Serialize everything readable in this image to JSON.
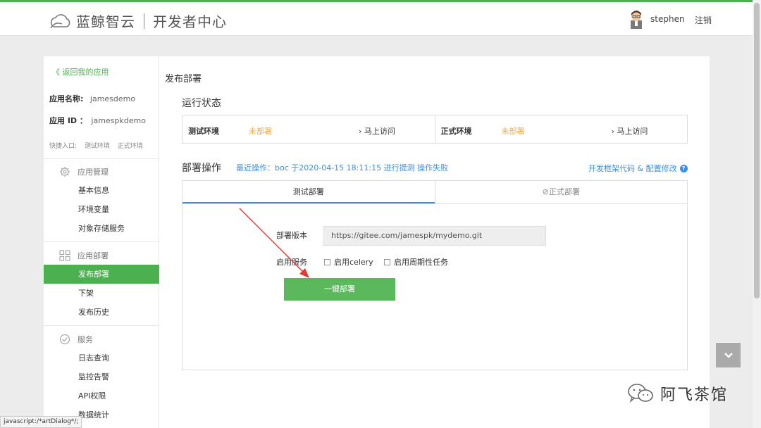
{
  "header": {
    "logo_text": "蓝鲸智云",
    "logo_sub": "开发者中心",
    "username": "stephen",
    "logout": "注销"
  },
  "sidebar": {
    "back_link": "《 返回我的应用",
    "app_name_label": "应用名称:",
    "app_name_value": "jamesdemo",
    "app_id_label": "应用 ID ：",
    "app_id_value": "jamespkdemo",
    "quick_label": "快捷入口:",
    "quick_test": "测试环境",
    "quick_prod": "正式环境",
    "groups": [
      {
        "title": "应用管理",
        "icon": "gear-icon",
        "items": [
          "基本信息",
          "环境变量",
          "对象存储服务"
        ]
      },
      {
        "title": "应用部署",
        "icon": "grid-icon",
        "items": [
          "发布部署",
          "下架",
          "发布历史"
        ]
      },
      {
        "title": "服务",
        "icon": "check-circle-icon",
        "items": [
          "日志查询",
          "监控告警",
          "API权限",
          "数据统计"
        ]
      }
    ]
  },
  "main": {
    "page_title": "发布部署",
    "status_title": "运行状态",
    "test_env": {
      "name": "测试环境",
      "status": "未部署",
      "visit": "马上访问"
    },
    "prod_env": {
      "name": "正式环境",
      "status": "未部署",
      "visit": "马上访问"
    },
    "ops_title": "部署操作",
    "last_op": "最近操作：boc 于2020-04-15 18:11:15 进行提测 操作失败",
    "help_link": "开发框架代码 & 配置修改",
    "tabs": [
      "测试部署",
      "⊘正式部署"
    ],
    "version_label": "部署版本",
    "version_value": "https://gitee.com/jamespk/mydemo.git",
    "service_label": "启用服务",
    "celery_label": "启用celery",
    "periodic_label": "启用周期性任务",
    "deploy_button": "一键部署"
  },
  "statusbar": {
    "url": "javascript:/*artDialog*/;"
  },
  "watermark": {
    "text": "阿飞茶馆"
  },
  "colors": {
    "accent": "#4caf50",
    "link": "#3a8ee6",
    "warning": "#f0ad4e",
    "button": "#5cb85c",
    "annotation_arrow": "#e53935"
  }
}
